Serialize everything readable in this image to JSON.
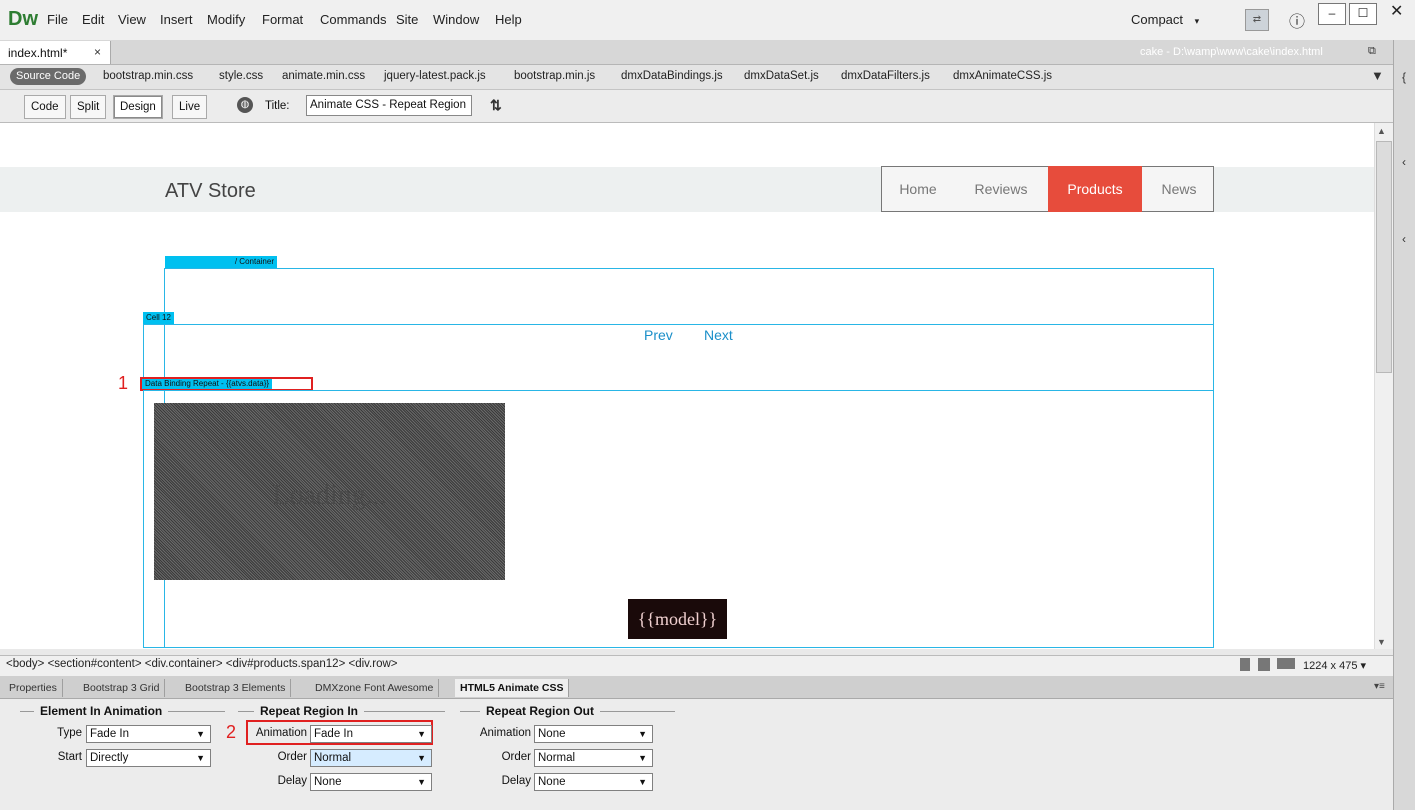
{
  "app": {
    "logo": "Dw",
    "workspace": "Compact",
    "sync_glyph": "⇄",
    "info_glyph": "ⓘ",
    "minimize": "–",
    "maximize": "☐",
    "close": "✕"
  },
  "menu": [
    "File",
    "Edit",
    "View",
    "Insert",
    "Modify",
    "Format",
    "Commands",
    "Site",
    "Window",
    "Help"
  ],
  "document": {
    "tab_label": "index.html*",
    "tab_close": "×",
    "path": "cake - D:\\wamp\\www\\cake\\index.html"
  },
  "related_files": {
    "source_label": "Source Code",
    "files": [
      "bootstrap.min.css",
      "style.css",
      "animate.min.css",
      "jquery-latest.pack.js",
      "bootstrap.min.js",
      "dmxDataBindings.js",
      "dmxDataSet.js",
      "dmxDataFilters.js",
      "dmxAnimateCSS.js"
    ]
  },
  "doc_toolbar": {
    "views": [
      "Code",
      "Split",
      "Design",
      "Live"
    ],
    "active_view": "Design",
    "title_label": "Title:",
    "title_value": "Animate CSS - Repeat Region"
  },
  "page": {
    "brand": "ATV Store",
    "nav": [
      "Home",
      "Reviews",
      "Products",
      "News"
    ],
    "active_nav": "Products",
    "container_tag": "/ Container",
    "cell_tag": "Cell 12",
    "pager": {
      "prev": "Prev",
      "next": "Next"
    },
    "repeat_tag": "Data Binding Repeat - {{atvs.data}}",
    "image_text": "Loading...",
    "model_text": "{{model}}"
  },
  "markers": {
    "one": "1",
    "two": "2"
  },
  "tag_selector": {
    "path": "<body> <section#content> <div.container> <div#products.span12> <div.row>",
    "size": "1224 x 475 ▾"
  },
  "panel_tabs": [
    "Properties",
    "Bootstrap 3 Grid",
    "Bootstrap 3 Elements",
    "DMXzone Font Awesome",
    "HTML5 Animate CSS"
  ],
  "active_panel": "HTML5 Animate CSS",
  "properties": {
    "element_in": {
      "title": "Element In Animation",
      "type_label": "Type",
      "type_value": "Fade In",
      "start_label": "Start",
      "start_value": "Directly"
    },
    "repeat_in": {
      "title": "Repeat Region In",
      "animation_label": "Animation",
      "animation_value": "Fade In",
      "order_label": "Order",
      "order_value": "Normal",
      "delay_label": "Delay",
      "delay_value": "None"
    },
    "repeat_out": {
      "title": "Repeat Region Out",
      "animation_label": "Animation",
      "animation_value": "None",
      "order_label": "Order",
      "order_value": "Normal",
      "delay_label": "Delay",
      "delay_value": "None"
    }
  }
}
